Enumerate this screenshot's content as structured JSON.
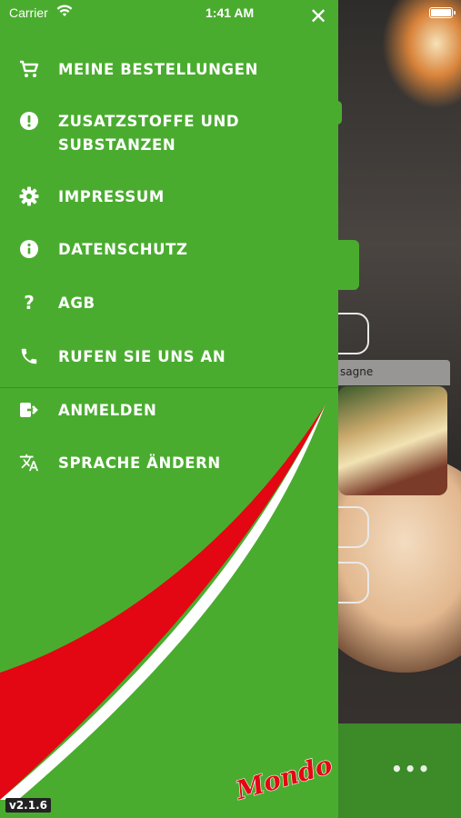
{
  "status_bar": {
    "carrier": "Carrier",
    "time": "1:41 AM"
  },
  "menu": {
    "items": [
      {
        "label": "MEINE BESTELLUNGEN",
        "icon": "cart-icon"
      },
      {
        "label": "ZUSATZSTOFFE UND SUBSTANZEN",
        "icon": "alert-circle-icon"
      },
      {
        "label": "IMPRESSUM",
        "icon": "gear-icon"
      },
      {
        "label": "DATENSCHUTZ",
        "icon": "info-circle-icon"
      },
      {
        "label": "AGB",
        "icon": "question-icon"
      },
      {
        "label": "RUFEN SIE UNS AN",
        "icon": "phone-icon"
      },
      {
        "label": "ANMELDEN",
        "icon": "login-icon"
      },
      {
        "label": "SPRACHE ÄNDERN",
        "icon": "translate-icon"
      }
    ]
  },
  "background": {
    "card_label": "sagne"
  },
  "footer": {
    "version": "v2.1.6",
    "logo_text": "Mondo"
  },
  "colors": {
    "drawer": "#4aac2f",
    "swoosh_red": "#e30613",
    "swoosh_white": "#ffffff"
  }
}
